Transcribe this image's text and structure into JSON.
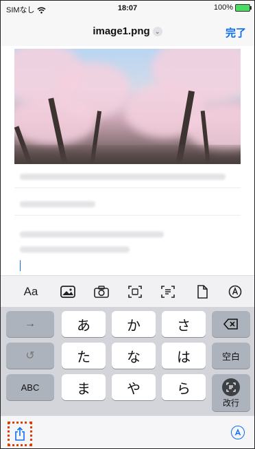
{
  "status": {
    "carrier": "SIMなし",
    "time": "18:07",
    "battery": "100%"
  },
  "nav": {
    "title": "image1.png",
    "done_label": "完了"
  },
  "toolbar": {
    "format_label": "Aa",
    "icons": [
      "photo-library-icon",
      "camera-icon",
      "scan-text-icon",
      "scan-document-icon",
      "file-icon",
      "markup-icon"
    ]
  },
  "keyboard": {
    "rows": [
      [
        "→",
        "あ",
        "か",
        "さ",
        "⌫"
      ],
      [
        "↺",
        "た",
        "な",
        "は",
        "空白"
      ],
      [
        "ABC",
        "ま",
        "や",
        "ら",
        "改行"
      ]
    ]
  },
  "bottom_bar": {
    "left_icon": "share-icon",
    "right_icon": "markup-icon"
  },
  "colors": {
    "accent": "#0a6cf0",
    "highlight": "#e23d00"
  }
}
